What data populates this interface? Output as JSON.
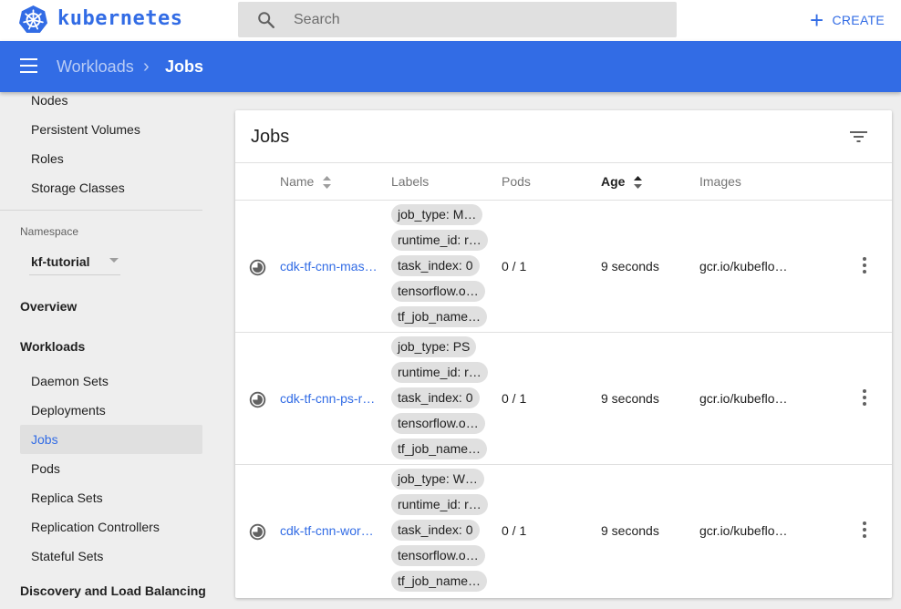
{
  "header": {
    "brand": "kubernetes",
    "search_placeholder": "Search",
    "create_label": "CREATE"
  },
  "breadcrumb": {
    "parent": "Workloads",
    "separator": "›",
    "current": "Jobs"
  },
  "sidebar": {
    "cluster_items": [
      "Nodes",
      "Persistent Volumes",
      "Roles",
      "Storage Classes"
    ],
    "namespace_label": "Namespace",
    "namespace_value": "kf-tutorial",
    "overview": "Overview",
    "workloads": "Workloads",
    "workload_items": [
      "Daemon Sets",
      "Deployments",
      "Jobs",
      "Pods",
      "Replica Sets",
      "Replication Controllers",
      "Stateful Sets"
    ],
    "active_item": "Jobs",
    "discovery": "Discovery and Load Balancing"
  },
  "card": {
    "title": "Jobs",
    "columns": [
      "Name",
      "Labels",
      "Pods",
      "Age",
      "Images"
    ],
    "sorted_column": "Age",
    "rows": [
      {
        "name": "cdk-tf-cnn-mas…",
        "labels": [
          "job_type: M…",
          "runtime_id: r…",
          "task_index: 0",
          "tensorflow.o…",
          "tf_job_name…"
        ],
        "pods": "0 / 1",
        "age": "9 seconds",
        "image": "gcr.io/kubeflo…"
      },
      {
        "name": "cdk-tf-cnn-ps-r…",
        "labels": [
          "job_type: PS",
          "runtime_id: r…",
          "task_index: 0",
          "tensorflow.o…",
          "tf_job_name…"
        ],
        "pods": "0 / 1",
        "age": "9 seconds",
        "image": "gcr.io/kubeflo…"
      },
      {
        "name": "cdk-tf-cnn-wor…",
        "labels": [
          "job_type: W…",
          "runtime_id: r…",
          "task_index: 0",
          "tensorflow.o…",
          "tf_job_name…"
        ],
        "pods": "0 / 1",
        "age": "9 seconds",
        "image": "gcr.io/kubeflo…"
      }
    ]
  },
  "colors": {
    "accent": "#326ce5",
    "navbar": "#326ce5",
    "chip_bg": "#e0e0e0",
    "page_bg": "#eeeeee"
  },
  "icons": {
    "logo": "kubernetes-helm-icon",
    "search": "search-icon",
    "create": "plus-icon",
    "menu": "hamburger-menu-icon",
    "filter": "filter-icon",
    "status": "pending-status-icon",
    "row_menu": "more-vert-icon"
  }
}
